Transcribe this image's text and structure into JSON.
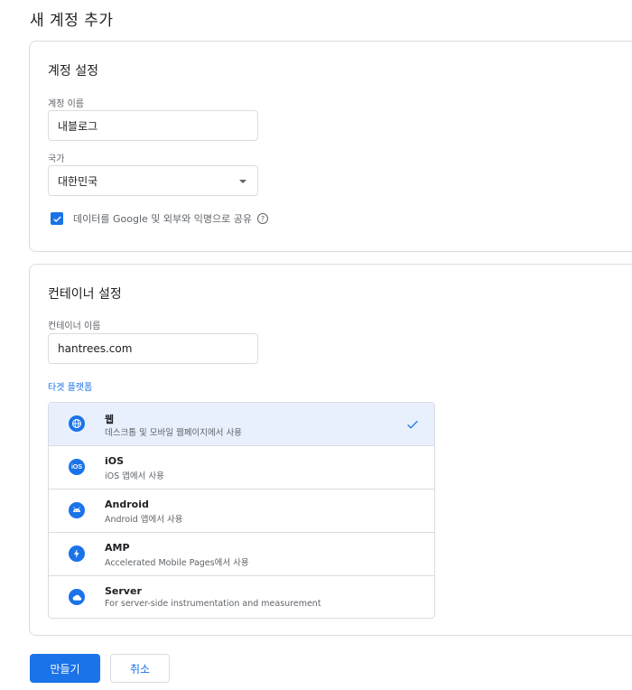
{
  "page": {
    "title": "새 계정 추가"
  },
  "account": {
    "section_title": "계정 설정",
    "name_label": "계정 이름",
    "name_value": "내블로그",
    "country_label": "국가",
    "country_value": "대한민국",
    "share_label": "데이터를 Google 및 외부와 익명으로 공유",
    "share_checked": true,
    "help_icon": "help-circle-icon"
  },
  "container": {
    "section_title": "컨테이너 설정",
    "name_label": "컨테이너 이름",
    "name_value": "hantrees.com",
    "target_label": "타겟 플랫폼",
    "platforms": [
      {
        "name": "웹",
        "desc": "데스크톱 및 모바일 웹페이지에서 사용",
        "icon": "globe-icon",
        "selected": true
      },
      {
        "name": "iOS",
        "desc": "iOS 앱에서 사용",
        "icon": "ios-icon",
        "selected": false
      },
      {
        "name": "Android",
        "desc": "Android 앱에서 사용",
        "icon": "android-icon",
        "selected": false
      },
      {
        "name": "AMP",
        "desc": "Accelerated Mobile Pages에서 사용",
        "icon": "bolt-icon",
        "selected": false
      },
      {
        "name": "Server",
        "desc": "For server-side instrumentation and measurement",
        "icon": "cloud-icon",
        "selected": false
      }
    ]
  },
  "actions": {
    "create_label": "만들기",
    "cancel_label": "취소"
  },
  "colors": {
    "accent": "#1a73e8",
    "selected_bg": "#e8f0fe",
    "border": "#dadce0"
  }
}
